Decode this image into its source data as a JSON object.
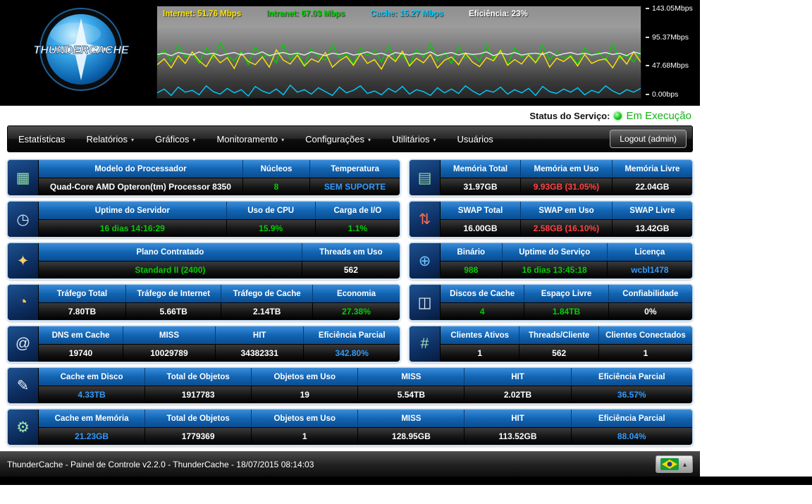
{
  "header": {
    "logo_text": "THUNDERCACHE",
    "graph": {
      "legend": [
        {
          "id": "internet",
          "label": "Internet: 51.76 Mbps",
          "color": "#ffe400"
        },
        {
          "id": "intranet",
          "label": "Intranet: 67.03 Mbps",
          "color": "#00d000"
        },
        {
          "id": "cache",
          "label": "Cache: 15.27 Mbps",
          "color": "#00ccff"
        },
        {
          "id": "eficiencia",
          "label": "Eficiência: 23%",
          "color": "#ffffff"
        }
      ],
      "y_axis": [
        "143.05Mbps",
        "95.37Mbps",
        "47.68Mbps",
        "0.00bps"
      ],
      "y_max": 143.05,
      "series": [
        {
          "id": "intranet",
          "color": "#00d000",
          "points": [
            62,
            75,
            57,
            82,
            64,
            70,
            54,
            78,
            61,
            86,
            66,
            58,
            73,
            52,
            80,
            63,
            69,
            55,
            84,
            60,
            72,
            51,
            77,
            65,
            59,
            83,
            62,
            70,
            53,
            79,
            66,
            74,
            56,
            81,
            60,
            68,
            50,
            76,
            63,
            85,
            58,
            71,
            54,
            80,
            62,
            69,
            57,
            83,
            61,
            75,
            52,
            78,
            64,
            70,
            55,
            82,
            59,
            73,
            62,
            67,
            53,
            79,
            65,
            72,
            58,
            84,
            61,
            68,
            56,
            74
          ]
        },
        {
          "id": "internet",
          "color": "#ffe400",
          "points": [
            52,
            61,
            47,
            66,
            54,
            72,
            58,
            49,
            68,
            55,
            63,
            46,
            70,
            57,
            52,
            64,
            48,
            75,
            59,
            53,
            67,
            50,
            61,
            56,
            71,
            48,
            58,
            65,
            51,
            69,
            54,
            60,
            45,
            66,
            57,
            73,
            50,
            62,
            55,
            68,
            47,
            59,
            64,
            52,
            70,
            56,
            49,
            63,
            58,
            74,
            51,
            60,
            53,
            67,
            55,
            71,
            48,
            62,
            57,
            65,
            50,
            68,
            54,
            59,
            61,
            47,
            66,
            53,
            72,
            56
          ]
        },
        {
          "id": "eficiencia",
          "color": "#e8e8e8",
          "points": [
            68,
            70,
            66,
            71,
            69,
            67,
            72,
            68,
            70,
            66,
            69,
            71,
            67,
            70,
            68,
            72,
            66,
            69,
            71,
            68,
            70,
            67,
            72,
            69,
            66,
            70,
            68,
            71,
            67,
            69,
            72,
            68,
            70,
            66,
            71,
            69,
            67,
            70,
            68,
            72,
            66,
            69,
            71,
            67,
            70,
            68,
            69,
            72,
            66,
            70,
            68,
            71,
            67,
            69,
            70,
            68,
            72,
            66,
            69,
            71,
            68,
            70,
            67,
            69,
            71,
            68,
            70,
            66,
            72,
            69
          ]
        },
        {
          "id": "cache",
          "color": "#00ccff",
          "points": [
            8,
            14,
            4,
            17,
            9,
            12,
            5,
            19,
            10,
            6,
            15,
            8,
            13,
            3,
            18,
            11,
            7,
            14,
            5,
            20,
            9,
            13,
            6,
            16,
            10,
            4,
            17,
            8,
            12,
            19,
            7,
            11,
            5,
            15,
            9,
            18,
            6,
            13,
            10,
            4,
            16,
            8,
            14,
            7,
            19,
            11,
            5,
            12,
            9,
            17,
            6,
            13,
            8,
            15,
            4,
            18,
            10,
            7,
            14,
            9,
            16,
            5,
            12,
            8,
            19,
            11,
            6,
            13,
            9,
            15
          ]
        }
      ]
    }
  },
  "status_bar": {
    "label": "Status do Serviço:",
    "value": "Em Execução"
  },
  "nav": {
    "items": [
      {
        "id": "estatisticas",
        "label": "Estatísticas",
        "dropdown": false
      },
      {
        "id": "relatorios",
        "label": "Relatórios",
        "dropdown": true
      },
      {
        "id": "graficos",
        "label": "Gráficos",
        "dropdown": true
      },
      {
        "id": "monitoramento",
        "label": "Monitoramento",
        "dropdown": true
      },
      {
        "id": "configuracoes",
        "label": "Configurações",
        "dropdown": true
      },
      {
        "id": "utilitarios",
        "label": "Utilitários",
        "dropdown": true
      },
      {
        "id": "usuarios",
        "label": "Usuários",
        "dropdown": false
      }
    ],
    "logout_label": "Logout (admin)"
  },
  "panels": [
    {
      "id": "processor",
      "col": "left",
      "icon": "cpu-icon",
      "glyph": "▦",
      "icon_color": "#8fe0a0",
      "cells": [
        {
          "h": "Modelo do Processador",
          "v": "Quad-Core AMD Opteron(tm) Processor 8350",
          "c": "white",
          "w": 2.6
        },
        {
          "h": "Núcleos",
          "v": "8",
          "c": "green",
          "w": 0.8
        },
        {
          "h": "Temperatura",
          "v": "SEM SUPORTE",
          "c": "blue",
          "w": 1.1
        }
      ]
    },
    {
      "id": "memory",
      "col": "right",
      "icon": "memory-icon",
      "glyph": "▤",
      "icon_color": "#8fe0a0",
      "cells": [
        {
          "h": "Memória Total",
          "v": "31.97GB",
          "c": "white",
          "w": 1
        },
        {
          "h": "Memória em Uso",
          "v": "9.93GB (31.05%)",
          "c": "red",
          "w": 1.15
        },
        {
          "h": "Memória Livre",
          "v": "22.04GB",
          "c": "white",
          "w": 1
        }
      ]
    },
    {
      "id": "uptime-server",
      "col": "left",
      "icon": "monitor-clock-icon",
      "glyph": "◷",
      "icon_color": "#cfe2f5",
      "cells": [
        {
          "h": "Uptime do Servidor",
          "v": "16 dias 14:16:29",
          "c": "green",
          "w": 2.2
        },
        {
          "h": "Uso de CPU",
          "v": "15.9%",
          "c": "green",
          "w": 1
        },
        {
          "h": "Carga de I/O",
          "v": "1.1%",
          "c": "green",
          "w": 0.95
        }
      ]
    },
    {
      "id": "swap",
      "col": "right",
      "icon": "swap-arrows-icon",
      "glyph": "⇅",
      "icon_color": "#ff6a4d",
      "cells": [
        {
          "h": "SWAP Total",
          "v": "16.00GB",
          "c": "white",
          "w": 1
        },
        {
          "h": "SWAP em Uso",
          "v": "2.58GB (16.10%)",
          "c": "red",
          "w": 1.15
        },
        {
          "h": "SWAP Livre",
          "v": "13.42GB",
          "c": "white",
          "w": 1
        }
      ]
    },
    {
      "id": "plan",
      "col": "left",
      "icon": "handshake-icon",
      "glyph": "✦",
      "icon_color": "#f0d070",
      "cells": [
        {
          "h": "Plano Contratado",
          "v": "Standard II (2400)",
          "c": "green",
          "w": 2.8
        },
        {
          "h": "Threads em Uso",
          "v": "562",
          "c": "white",
          "w": 1
        }
      ]
    },
    {
      "id": "binary",
      "col": "right",
      "icon": "globe-icon",
      "glyph": "⊕",
      "icon_color": "#6fc4ff",
      "cells": [
        {
          "h": "Binário",
          "v": "988",
          "c": "green",
          "w": 0.7
        },
        {
          "h": "Uptime do Serviço",
          "v": "16 dias 13:45:18",
          "c": "green",
          "w": 1.25
        },
        {
          "h": "Licença",
          "v": "wcbl1478",
          "c": "blue",
          "w": 1
        }
      ]
    },
    {
      "id": "traffic",
      "col": "left",
      "icon": "pie-chart-icon",
      "glyph": "◔",
      "icon_color": "#ffd23e",
      "cells": [
        {
          "h": "Tráfego Total",
          "v": "7.80TB",
          "c": "white",
          "w": 1
        },
        {
          "h": "Tráfego de Internet",
          "v": "5.66TB",
          "c": "white",
          "w": 1.1
        },
        {
          "h": "Tráfego de Cache",
          "v": "2.14TB",
          "c": "white",
          "w": 1.05
        },
        {
          "h": "Economia",
          "v": "27.38%",
          "c": "green",
          "w": 1
        }
      ]
    },
    {
      "id": "cache-disks",
      "col": "right",
      "icon": "disk-icon",
      "glyph": "◫",
      "icon_color": "#e8eef5",
      "cells": [
        {
          "h": "Discos de Cache",
          "v": "4",
          "c": "green",
          "w": 1
        },
        {
          "h": "Espaço Livre",
          "v": "1.84TB",
          "c": "green",
          "w": 1
        },
        {
          "h": "Confiabilidade",
          "v": "0%",
          "c": "white",
          "w": 1
        }
      ]
    },
    {
      "id": "dns",
      "col": "left",
      "icon": "magnifier-at-icon",
      "glyph": "@",
      "icon_color": "#dfe8f2",
      "cells": [
        {
          "h": "DNS em Cache",
          "v": "19740",
          "c": "white",
          "w": 1
        },
        {
          "h": "MISS",
          "v": "10029789",
          "c": "white",
          "w": 1.1
        },
        {
          "h": "HIT",
          "v": "34382331",
          "c": "white",
          "w": 1.05
        },
        {
          "h": "Eficiência Parcial",
          "v": "342.80%",
          "c": "blue",
          "w": 1.15
        }
      ]
    },
    {
      "id": "clients",
      "col": "right",
      "icon": "network-tree-icon",
      "glyph": "#",
      "icon_color": "#9fe2ae",
      "cells": [
        {
          "h": "Clientes Ativos",
          "v": "1",
          "c": "white",
          "w": 1
        },
        {
          "h": "Threads/Cliente",
          "v": "562",
          "c": "white",
          "w": 1
        },
        {
          "h": "Clientes Conectados",
          "v": "1",
          "c": "white",
          "w": 1.2
        }
      ]
    },
    {
      "id": "disk-cache",
      "col": "full",
      "icon": "quill-icon",
      "glyph": "✎",
      "icon_color": "#eef3f8",
      "cells": [
        {
          "h": "Cache em Disco",
          "v": "4.33TB",
          "c": "blue",
          "w": 1
        },
        {
          "h": "Total de Objetos",
          "v": "1917783",
          "c": "white",
          "w": 1
        },
        {
          "h": "Objetos em Uso",
          "v": "19",
          "c": "white",
          "w": 1
        },
        {
          "h": "MISS",
          "v": "5.54TB",
          "c": "white",
          "w": 1
        },
        {
          "h": "HIT",
          "v": "2.02TB",
          "c": "white",
          "w": 1
        },
        {
          "h": "Eficiência Parcial",
          "v": "36.57%",
          "c": "blue",
          "w": 1.15
        }
      ]
    },
    {
      "id": "memory-cache",
      "col": "full",
      "icon": "screws-icon",
      "glyph": "⚙",
      "icon_color": "#9fe2ae",
      "cells": [
        {
          "h": "Cache em Memória",
          "v": "21.23GB",
          "c": "blue",
          "w": 1
        },
        {
          "h": "Total de Objetos",
          "v": "1779369",
          "c": "white",
          "w": 1
        },
        {
          "h": "Objetos em Uso",
          "v": "1",
          "c": "white",
          "w": 1
        },
        {
          "h": "MISS",
          "v": "128.95GB",
          "c": "white",
          "w": 1
        },
        {
          "h": "HIT",
          "v": "113.52GB",
          "c": "white",
          "w": 1
        },
        {
          "h": "Eficiência Parcial",
          "v": "88.04%",
          "c": "blue",
          "w": 1.15
        }
      ]
    }
  ],
  "footer": {
    "text": "ThunderCache - Painel de Controle v2.2.0 - ThunderCache - 18/07/2015 08:14:03"
  }
}
